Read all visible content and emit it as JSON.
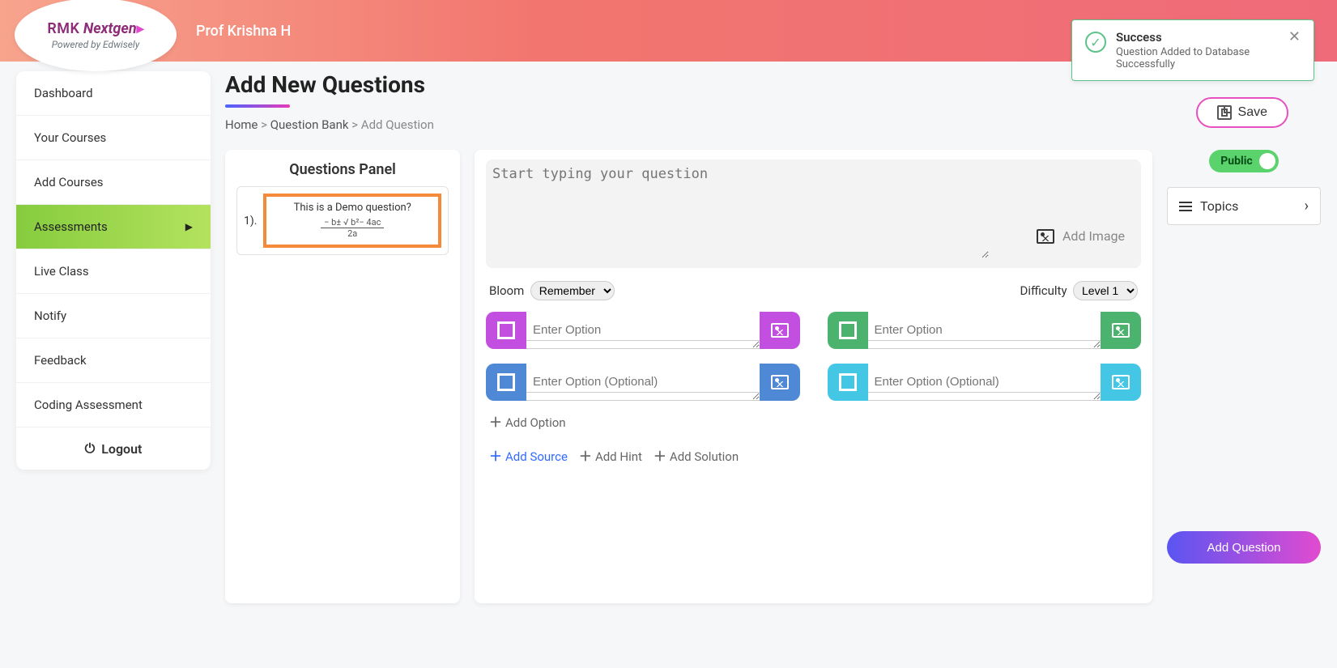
{
  "header": {
    "logo_top_1": "RMK",
    "logo_top_2": "Nextgen",
    "logo_sub": "Powered by Edwisely",
    "prof": "Prof Krishna H"
  },
  "toast": {
    "title": "Success",
    "message": "Question Added to Database Successfully"
  },
  "sidebar": {
    "items": [
      {
        "label": "Dashboard"
      },
      {
        "label": "Your Courses"
      },
      {
        "label": "Add Courses"
      },
      {
        "label": "Assessments"
      },
      {
        "label": "Live Class"
      },
      {
        "label": "Notify"
      },
      {
        "label": "Feedback"
      },
      {
        "label": "Coding Assessment"
      }
    ],
    "logout": "Logout"
  },
  "page": {
    "title": "Add New Questions",
    "breadcrumb": {
      "home": "Home",
      "bank": "Question Bank",
      "add": "Add Question"
    },
    "save": "Save"
  },
  "panel": {
    "title": "Questions Panel",
    "questions": [
      {
        "num": "1).",
        "text": "This is a Demo question?",
        "formula_top": "− b± √ b²− 4ac",
        "formula_bot": "2a"
      }
    ]
  },
  "editor": {
    "placeholder": "Start typing your question",
    "add_image": "Add Image",
    "bloom_label": "Bloom",
    "bloom_value": "Remember",
    "difficulty_label": "Difficulty",
    "difficulty_value": "Level 1",
    "options": {
      "a": "Enter Option",
      "b": "Enter Option",
      "c": "Enter Option (Optional)",
      "d": "Enter Option (Optional)"
    },
    "add_option": "Add Option",
    "add_source": "Add Source",
    "add_hint": "Add Hint",
    "add_solution": "Add Solution"
  },
  "right": {
    "public": "Public",
    "topics": "Topics",
    "add_question": "Add Question"
  }
}
